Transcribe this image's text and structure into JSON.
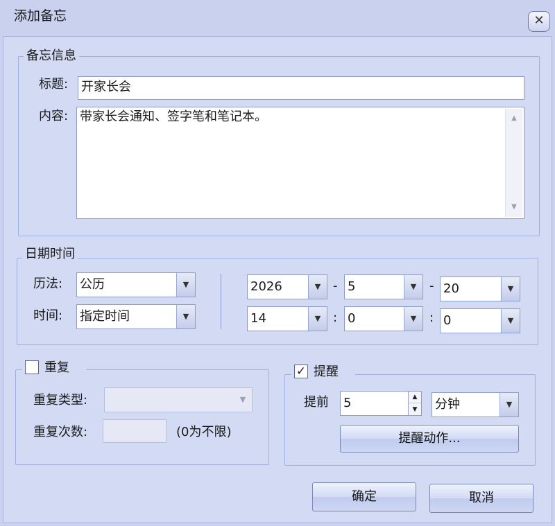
{
  "window": {
    "title": "添加备忘",
    "close_glyph": "✕"
  },
  "memo_info": {
    "legend": "备忘信息",
    "title_label": "标题:",
    "title_value": "开家长会",
    "content_label": "内容:",
    "content_value": "带家长会通知、签字笔和笔记本。"
  },
  "datetime": {
    "legend": "日期时间",
    "calendar_label": "历法:",
    "calendar_value": "公历",
    "time_label": "时间:",
    "time_value": "指定时间",
    "year": "2026",
    "month": "5",
    "day": "20",
    "hour": "14",
    "minute": "0",
    "second": "0",
    "date_sep": "-",
    "time_sep": ":"
  },
  "repeat": {
    "legend": "重复",
    "checked": false,
    "type_label": "重复类型:",
    "type_value": "",
    "count_label": "重复次数:",
    "count_value": "",
    "count_hint": "(0为不限)"
  },
  "reminder": {
    "legend": "提醒",
    "checked": true,
    "check_glyph": "✓",
    "advance_label": "提前",
    "advance_value": "5",
    "unit_value": "分钟",
    "action_button": "提醒动作..."
  },
  "buttons": {
    "ok": "确定",
    "cancel": "取消"
  },
  "icons": {
    "dropdown": "▼",
    "scroll_up": "▲",
    "scroll_down": "▼",
    "spin_up": "▲",
    "spin_down": "▼"
  }
}
